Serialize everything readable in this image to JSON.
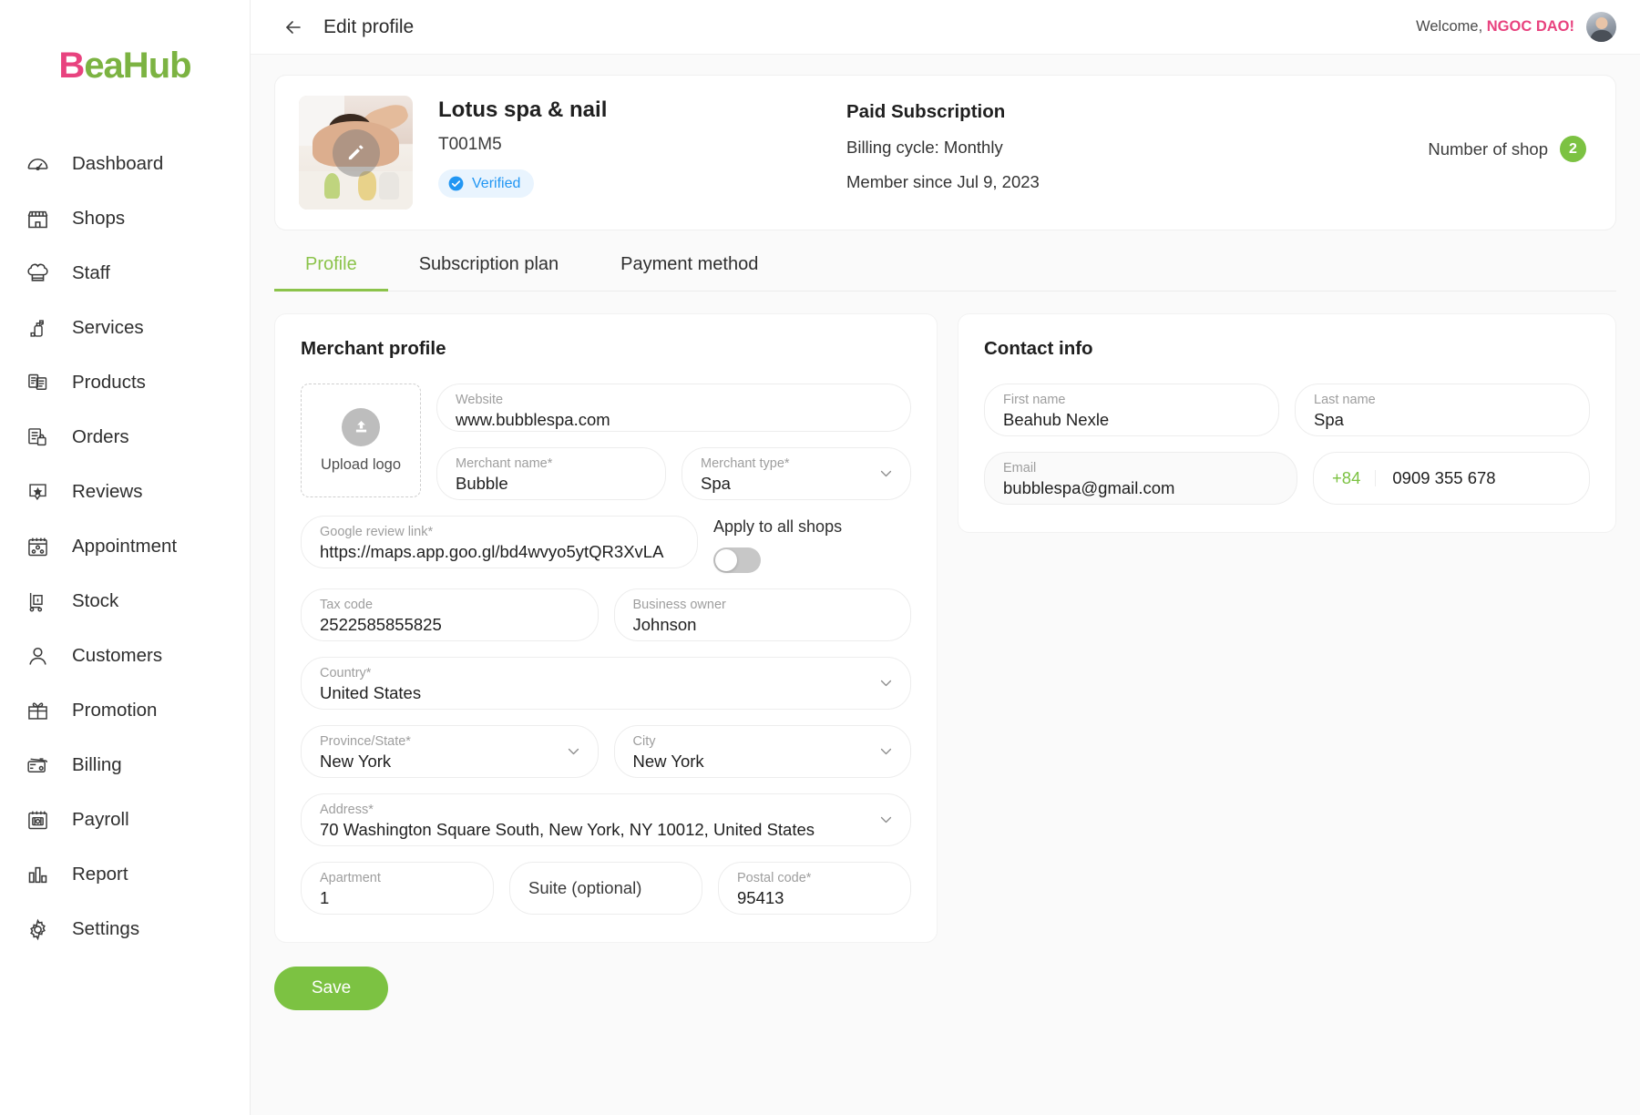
{
  "brand": {
    "logo_b": "B",
    "logo_rest": "eaHub",
    "pink": "#e8437f",
    "green": "#7cb342"
  },
  "sidebar": {
    "items": [
      {
        "label": "Dashboard",
        "icon": "dashboard-icon"
      },
      {
        "label": "Shops",
        "icon": "shop-icon"
      },
      {
        "label": "Staff",
        "icon": "chef-hat-icon"
      },
      {
        "label": "Services",
        "icon": "lotion-bottle-icon"
      },
      {
        "label": "Products",
        "icon": "documents-icon"
      },
      {
        "label": "Orders",
        "icon": "order-list-icon"
      },
      {
        "label": "Reviews",
        "icon": "star-badge-icon"
      },
      {
        "label": "Appointment",
        "icon": "calendar-people-icon"
      },
      {
        "label": "Stock",
        "icon": "hand-truck-icon"
      },
      {
        "label": "Customers",
        "icon": "user-icon"
      },
      {
        "label": "Promotion",
        "icon": "gift-icon"
      },
      {
        "label": "Billing",
        "icon": "credit-card-icon"
      },
      {
        "label": "Payroll",
        "icon": "payroll-calendar-icon"
      },
      {
        "label": "Report",
        "icon": "bar-chart-icon"
      },
      {
        "label": "Settings",
        "icon": "gear-icon"
      }
    ]
  },
  "topbar": {
    "title": "Edit profile",
    "back_icon": "arrow-left-icon",
    "welcome_prefix": "Welcome, ",
    "welcome_user": "NGOC DAO!"
  },
  "hero": {
    "shop_name": "Lotus spa & nail",
    "shop_code": "T001M5",
    "verified_label": "Verified",
    "subscription_title": "Paid Subscription",
    "billing_cycle": "Billing cycle: Monthly",
    "member_since": "Member since Jul 9, 2023",
    "number_of_shop_label": "Number of shop",
    "number_of_shop_value": "2"
  },
  "tabs": [
    {
      "label": "Profile",
      "active": true
    },
    {
      "label": "Subscription plan",
      "active": false
    },
    {
      "label": "Payment method",
      "active": false
    }
  ],
  "merchant_profile": {
    "title": "Merchant profile",
    "upload_label": "Upload logo",
    "website": {
      "label": "Website",
      "value": "www.bubblespa.com"
    },
    "merchant_name": {
      "label": "Merchant name*",
      "value": "Bubble"
    },
    "merchant_type": {
      "label": "Merchant type*",
      "value": "Spa"
    },
    "google_review_link": {
      "label": "Google review link*",
      "value": "https://maps.app.goo.gl/bd4wvyo5ytQR3XvLA"
    },
    "apply_all_shops": {
      "label": "Apply to all shops",
      "enabled": false
    },
    "tax_code": {
      "label": "Tax code",
      "value": "2522585855825"
    },
    "business_owner": {
      "label": "Business owner",
      "value": "Johnson"
    },
    "country": {
      "label": "Country*",
      "value": "United States"
    },
    "province": {
      "label": "Province/State*",
      "value": "New York"
    },
    "city": {
      "label": "City",
      "value": "New York"
    },
    "address": {
      "label": "Address*",
      "value": "70 Washington Square South, New York, NY 10012, United States"
    },
    "apartment": {
      "label": "Apartment",
      "value": "1"
    },
    "suite": {
      "placeholder": "Suite (optional)"
    },
    "postal_code": {
      "label": "Postal code*",
      "value": "95413"
    }
  },
  "contact_info": {
    "title": "Contact info",
    "first_name": {
      "label": "First name",
      "value": "Beahub Nexle"
    },
    "last_name": {
      "label": "Last name",
      "value": "Spa"
    },
    "email": {
      "label": "Email",
      "value": "bubblespa@gmail.com"
    },
    "phone": {
      "country_code": "+84",
      "number": "0909 355 678"
    }
  },
  "actions": {
    "save_label": "Save"
  }
}
